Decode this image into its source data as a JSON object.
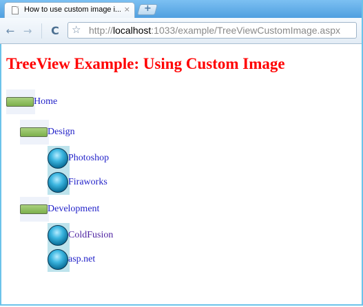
{
  "browser": {
    "tab_title": "How to use custom image i...",
    "tab_close": "×",
    "new_tab": "+",
    "back": "←",
    "forward": "→",
    "reload": "C",
    "star": "☆",
    "url_scheme": "http://",
    "url_host": "localhost",
    "url_rest": ":1033/example/TreeViewCustomImage.aspx"
  },
  "page": {
    "title": "TreeView Example: Using Custom Image"
  },
  "tree": {
    "root": {
      "label": "Home",
      "icon": "green-bar-icon"
    },
    "design": {
      "label": "Design",
      "icon": "green-bar-icon"
    },
    "photoshop": {
      "label": "Photoshop",
      "icon": "blue-ball-icon"
    },
    "fireworks": {
      "label": "Firaworks",
      "icon": "blue-ball-icon"
    },
    "development": {
      "label": "Development",
      "icon": "green-bar-icon"
    },
    "coldfusion": {
      "label": "ColdFusion",
      "icon": "blue-ball-icon"
    },
    "aspnet": {
      "label": "asp.net",
      "icon": "blue-ball-icon"
    }
  },
  "colors": {
    "title": "#ff0000",
    "link": "#1f1fc8",
    "visited_link": "#4b1fa0",
    "leaf_highlight": "#bde3ec"
  }
}
